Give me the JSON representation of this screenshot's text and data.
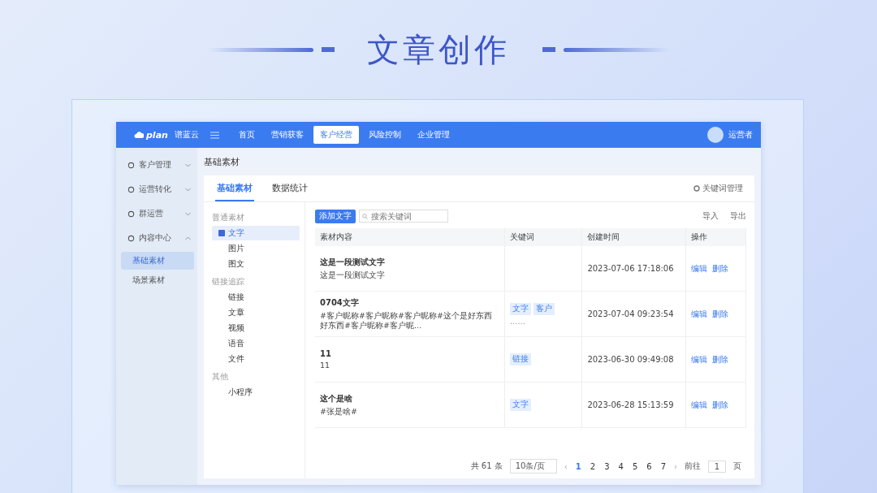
{
  "slide_title": "文章创作",
  "app": {
    "logo_text": "plan",
    "brand": "谱蓝云",
    "nav": [
      {
        "label": "首页",
        "selected": false
      },
      {
        "label": "营销获客",
        "selected": false
      },
      {
        "label": "客户经营",
        "selected": true
      },
      {
        "label": "风险控制",
        "selected": false
      },
      {
        "label": "企业管理",
        "selected": false
      }
    ],
    "user": "运营者",
    "sidebar": [
      {
        "label": "客户管理",
        "expanded": false
      },
      {
        "label": "运营转化",
        "expanded": false
      },
      {
        "label": "群运营",
        "expanded": false
      },
      {
        "label": "内容中心",
        "expanded": true,
        "children": [
          {
            "label": "基础素材",
            "selected": true
          },
          {
            "label": "场景素材",
            "selected": false
          }
        ]
      }
    ],
    "page_title": "基础素材",
    "tabs": [
      {
        "label": "基础素材",
        "selected": true
      },
      {
        "label": "数据统计",
        "selected": false
      }
    ],
    "keyword_link": "关键词管理",
    "categories": [
      {
        "group": "普通素材",
        "items": [
          {
            "label": "文字",
            "selected": true
          },
          {
            "label": "图片",
            "selected": false
          },
          {
            "label": "图文",
            "selected": false
          }
        ]
      },
      {
        "group": "链接追踪",
        "items": [
          {
            "label": "链接",
            "selected": false
          },
          {
            "label": "文章",
            "selected": false
          },
          {
            "label": "视频",
            "selected": false
          },
          {
            "label": "语音",
            "selected": false
          },
          {
            "label": "文件",
            "selected": false
          }
        ]
      },
      {
        "group": "其他",
        "items": [
          {
            "label": "小程序",
            "selected": false
          }
        ]
      }
    ],
    "add_button": "添加文字",
    "search": {
      "placeholder": "搜索关键词"
    },
    "import": "导入",
    "export": "导出",
    "table": {
      "columns": [
        "素材内容",
        "关键词",
        "创建时间",
        "操作"
      ],
      "rows": [
        {
          "title": "这是一段测试文字",
          "body": "这是一段测试文字",
          "keywords": [],
          "more": "",
          "time": "2023-07-06 17:18:06",
          "actions": [
            "编辑",
            "删除"
          ]
        },
        {
          "title": "0704文字",
          "body": "#客户昵称#客户昵称#客户昵称#这个是好东西好东西#客户昵称#客户昵...",
          "keywords": [
            "文字",
            "客户"
          ],
          "more": "......",
          "time": "2023-07-04 09:23:54",
          "actions": [
            "编辑",
            "删除"
          ]
        },
        {
          "title": "11",
          "body": "11",
          "keywords": [
            "链接"
          ],
          "more": "",
          "time": "2023-06-30 09:49:08",
          "actions": [
            "编辑",
            "删除"
          ]
        },
        {
          "title": "这个是啥",
          "body": "#张是啥#",
          "keywords": [
            "文字"
          ],
          "more": "",
          "time": "2023-06-28 15:13:59",
          "actions": [
            "编辑",
            "删除"
          ]
        }
      ]
    },
    "pagination": {
      "total": "共 61 条",
      "page_size": "10条/页",
      "pages": [
        {
          "label": "1",
          "selected": true
        },
        {
          "label": "2",
          "selected": false
        },
        {
          "label": "3",
          "selected": false
        },
        {
          "label": "4",
          "selected": false
        },
        {
          "label": "5",
          "selected": false
        },
        {
          "label": "6",
          "selected": false
        },
        {
          "label": "7",
          "selected": false
        }
      ],
      "prev": "‹",
      "next": "›",
      "goto_label": "前往",
      "goto_value": "1",
      "goto_suffix": "页"
    }
  }
}
